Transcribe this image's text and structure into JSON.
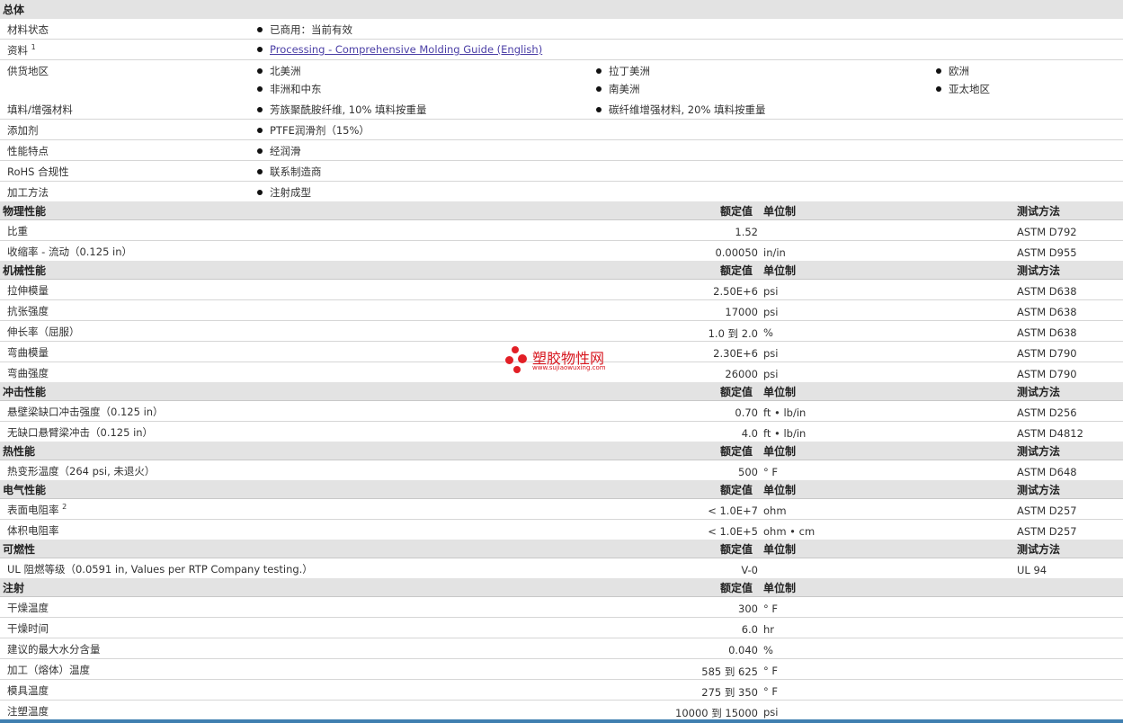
{
  "general": {
    "title": "总体",
    "rows": [
      {
        "label": "材料状态",
        "items": [
          "已商用：当前有效"
        ]
      },
      {
        "label": "资料",
        "sup": "1",
        "link": "Processing - Comprehensive Molding Guide (English)"
      },
      {
        "label": "供货地区",
        "items": [
          "北美洲",
          "拉丁美洲",
          "欧洲",
          "非洲和中东",
          "南美洲",
          "亚太地区"
        ]
      },
      {
        "label": "填料/增强材料",
        "items": [
          "芳族聚酰胺纤维, 10% 填料按重量",
          "碳纤维增强材料, 20% 填料按重量"
        ]
      },
      {
        "label": "添加剂",
        "items": [
          "PTFE润滑剂（15%）"
        ]
      },
      {
        "label": "性能特点",
        "items": [
          "经润滑"
        ]
      },
      {
        "label": "RoHS 合规性",
        "items": [
          "联系制造商"
        ]
      },
      {
        "label": "加工方法",
        "items": [
          "注射成型"
        ]
      }
    ]
  },
  "headers": {
    "value": "额定值",
    "unit": "单位制",
    "method": "测试方法"
  },
  "sections": {
    "physical": {
      "title": "物理性能",
      "rows": [
        {
          "label": "比重",
          "value": "1.52",
          "unit": "",
          "method": "ASTM D792"
        },
        {
          "label": "收缩率 - 流动（0.125 in）",
          "value": "0.00050",
          "unit": "in/in",
          "method": "ASTM D955"
        }
      ]
    },
    "mechanical": {
      "title": "机械性能",
      "rows": [
        {
          "label": "拉伸模量",
          "value": "2.50E+6",
          "unit": "psi",
          "method": "ASTM D638"
        },
        {
          "label": "抗张强度",
          "value": "17000",
          "unit": "psi",
          "method": "ASTM D638"
        },
        {
          "label": "伸长率（屈服）",
          "value": "1.0 到  2.0",
          "unit": "%",
          "method": "ASTM D638"
        },
        {
          "label": "弯曲模量",
          "value": "2.30E+6",
          "unit": "psi",
          "method": "ASTM D790"
        },
        {
          "label": "弯曲强度",
          "value": "26000",
          "unit": "psi",
          "method": "ASTM D790"
        }
      ]
    },
    "impact": {
      "title": "冲击性能",
      "rows": [
        {
          "label": "悬壁梁缺口冲击强度（0.125 in）",
          "value": "0.70",
          "unit": "ft • lb/in",
          "method": "ASTM D256"
        },
        {
          "label": "无缺口悬臂梁冲击（0.125 in）",
          "value": "4.0",
          "unit": "ft • lb/in",
          "method": "ASTM D4812"
        }
      ]
    },
    "thermal": {
      "title": "热性能",
      "rows": [
        {
          "label": "热变形温度（264 psi, 未退火）",
          "value": "500",
          "unit": "° F",
          "method": "ASTM D648"
        }
      ]
    },
    "electrical": {
      "title": "电气性能",
      "rows": [
        {
          "label": "表面电阻率",
          "sup": "2",
          "value": "< 1.0E+7",
          "unit": "ohm",
          "method": "ASTM D257"
        },
        {
          "label": "体积电阻率",
          "value": "< 1.0E+5",
          "unit": "ohm • cm",
          "method": "ASTM D257"
        }
      ]
    },
    "flammability": {
      "title": "可燃性",
      "rows": [
        {
          "label": "UL 阻燃等级（0.0591 in, Values per RTP Company testing.）",
          "value": "V-0",
          "unit": "",
          "method": "UL 94"
        }
      ]
    },
    "injection": {
      "title": "注射",
      "rows": [
        {
          "label": "干燥温度",
          "value": "300",
          "unit": "° F"
        },
        {
          "label": "干燥时间",
          "value": "6.0",
          "unit": "hr"
        },
        {
          "label": "建议的最大水分含量",
          "value": "0.040",
          "unit": "%"
        },
        {
          "label": "加工（熔体）温度",
          "value": "585 到  625",
          "unit": "° F"
        },
        {
          "label": "模具温度",
          "value": "275 到  350",
          "unit": "° F"
        },
        {
          "label": "注塑温度",
          "value": "10000 到  15000",
          "unit": "psi"
        }
      ]
    }
  },
  "watermark": {
    "name": "塑胶物性网",
    "url": "www.sujiaowuxing.com",
    "color": "#e21f26"
  }
}
